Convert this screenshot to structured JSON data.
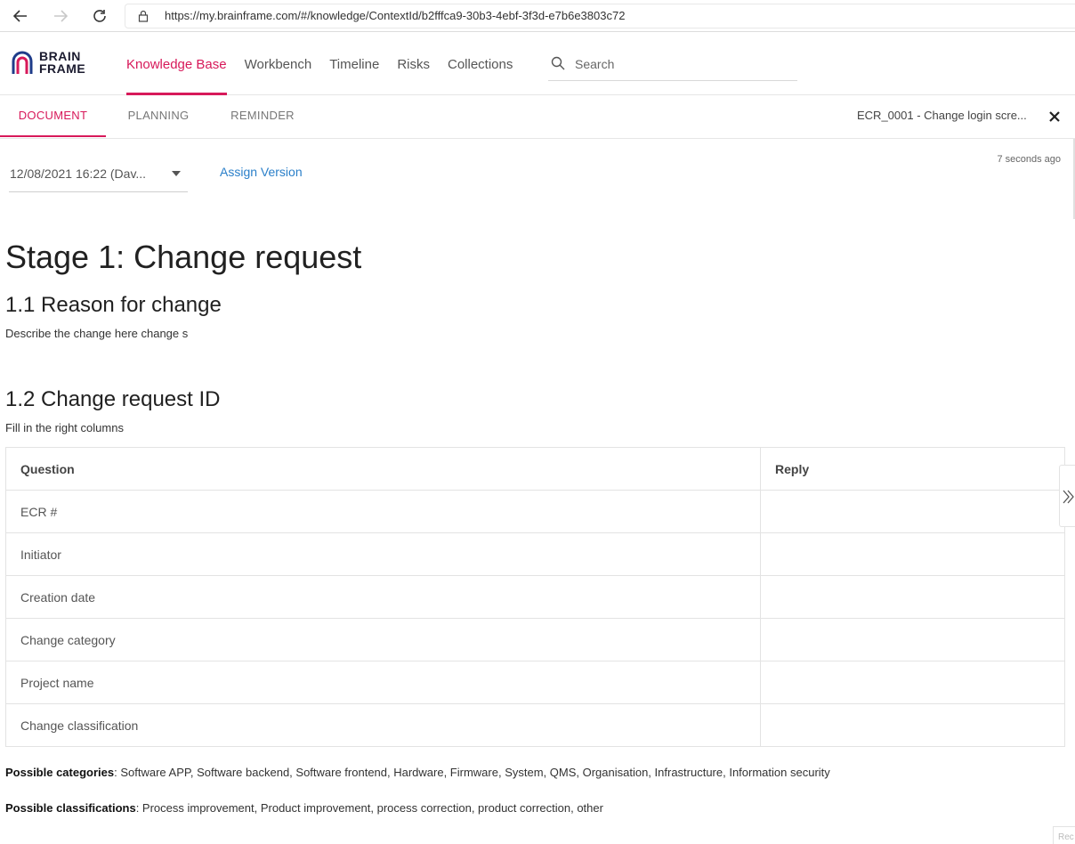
{
  "browser": {
    "url": "https://my.brainframe.com/#/knowledge/ContextId/b2fffca9-30b3-4ebf-3f3d-e7b6e3803c72"
  },
  "header": {
    "logo_top": "BRAIN",
    "logo_bottom": "FRAME",
    "nav": [
      {
        "label": "Knowledge Base",
        "active": true
      },
      {
        "label": "Workbench"
      },
      {
        "label": "Timeline"
      },
      {
        "label": "Risks"
      },
      {
        "label": "Collections"
      }
    ],
    "search_placeholder": "Search"
  },
  "subbar": {
    "tabs": [
      "DOCUMENT",
      "PLANNING",
      "REMINDER"
    ],
    "active_tab": "DOCUMENT",
    "doc_title": "ECR_0001 - Change login scre..."
  },
  "toolbar": {
    "version": "12/08/2021 16:22 (Dav...",
    "assign_label": "Assign Version",
    "timestamp": "7 seconds ago"
  },
  "document": {
    "h1": "Stage 1: Change request",
    "s1_title": "1.1 Reason for change",
    "s1_text": "Describe the change here change s",
    "s2_title": "1.2 Change request ID",
    "s2_text": "Fill in the right columns",
    "table": {
      "headers": [
        "Question",
        "Reply"
      ],
      "rows": [
        [
          "ECR #",
          ""
        ],
        [
          "Initiator",
          ""
        ],
        [
          "Creation date",
          ""
        ],
        [
          "Change category",
          ""
        ],
        [
          "Project name",
          ""
        ],
        [
          "Change classification",
          ""
        ]
      ]
    },
    "categories_label": "Possible categories",
    "categories_text": ": Software APP, Software backend, Software frontend, Hardware, Firmware, System, QMS, Organisation, Infrastructure, Information security",
    "classifications_label": "Possible classifications",
    "classifications_text": ": Process improvement, Product improvement, process correction, product correction, other"
  },
  "corner_label": "Rec",
  "colors": {
    "accent": "#d7195a",
    "link": "#2a7fc9"
  }
}
